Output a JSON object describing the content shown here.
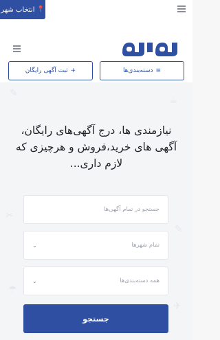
{
  "topbar": {
    "city_button_label": "انتخاب شهر",
    "menu_icon": "hamburger-icon"
  },
  "header": {
    "logo_text": "مارما",
    "menu_icon": "hamburger-icon",
    "categories_button_label": "دسته‌بندی‌ها",
    "post_ad_button_label": "ثبت آگهی رایگان"
  },
  "hero": {
    "text_lines": [
      "نیازمندی ها، درج آگهی‌های رایگان،",
      "آگهی های خرید،فروش و هرچیزی که",
      "لازم داری..."
    ]
  },
  "search": {
    "query_placeholder": "جستجو در تمام آگهی‌ها",
    "city_select_value": "تمام شهرها",
    "category_select_value": "همه دسته‌بندی‌ها",
    "submit_label": "جستجو"
  },
  "colors": {
    "brand_blue": "#2f4fa2",
    "background": "#f4f5f7"
  }
}
